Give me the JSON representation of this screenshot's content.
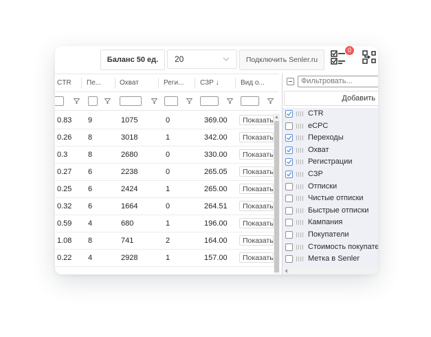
{
  "toolbar": {
    "balance_label": "Баланс 50 ед.",
    "page_size_value": "20",
    "connect_senler_label": "Подключить Senler.ru",
    "notification_count": "0"
  },
  "table": {
    "columns": [
      "CTR",
      "Пе...",
      "Охват",
      "Реги...",
      "СЗР ↓",
      "Вид о..."
    ],
    "rows": [
      {
        "ctr": "0.83",
        "pe": "9",
        "reach": "1075",
        "reg": "0",
        "szr": "369.00",
        "view": "Показать"
      },
      {
        "ctr": "0.26",
        "pe": "8",
        "reach": "3018",
        "reg": "1",
        "szr": "342.00",
        "view": "Показать"
      },
      {
        "ctr": "0.3",
        "pe": "8",
        "reach": "2680",
        "reg": "0",
        "szr": "330.00",
        "view": "Показать"
      },
      {
        "ctr": "0.27",
        "pe": "6",
        "reach": "2238",
        "reg": "0",
        "szr": "265.05",
        "view": "Показать"
      },
      {
        "ctr": "0.25",
        "pe": "6",
        "reach": "2424",
        "reg": "1",
        "szr": "265.00",
        "view": "Показать"
      },
      {
        "ctr": "0.32",
        "pe": "6",
        "reach": "1664",
        "reg": "0",
        "szr": "264.51",
        "view": "Показать"
      },
      {
        "ctr": "0.59",
        "pe": "4",
        "reach": "680",
        "reg": "1",
        "szr": "196.00",
        "view": "Показать"
      },
      {
        "ctr": "1.08",
        "pe": "8",
        "reach": "741",
        "reg": "2",
        "szr": "164.00",
        "view": "Показать"
      },
      {
        "ctr": "0.22",
        "pe": "4",
        "reach": "2928",
        "reg": "1",
        "szr": "157.00",
        "view": "Показать"
      }
    ]
  },
  "column_chooser": {
    "filter_placeholder": "Фильтровать...",
    "add_button_label": "Добавить",
    "items": [
      {
        "label": "CTR",
        "checked": true
      },
      {
        "label": "eCPC",
        "checked": false
      },
      {
        "label": "Переходы",
        "checked": true
      },
      {
        "label": "Охват",
        "checked": true
      },
      {
        "label": "Регистрации",
        "checked": true
      },
      {
        "label": "СЗР",
        "checked": true
      },
      {
        "label": "Отписки",
        "checked": false
      },
      {
        "label": "Чистые отписки",
        "checked": false
      },
      {
        "label": "Быстрые отписки",
        "checked": false
      },
      {
        "label": "Кампания",
        "checked": false
      },
      {
        "label": "Покупатели",
        "checked": false
      },
      {
        "label": "Стоимость покупателя",
        "checked": false
      },
      {
        "label": "Метка в Senler",
        "checked": false
      }
    ]
  },
  "colors": {
    "checkbox_accent": "#5b8fd7",
    "badge": "#ef5b5b",
    "panel_list_bg": "#eef0f6"
  }
}
